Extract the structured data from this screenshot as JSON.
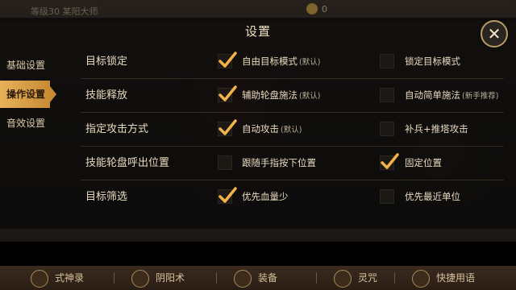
{
  "top": {
    "left_text": "等级30 某阳大师",
    "coins": "0"
  },
  "panel": {
    "title": "设置"
  },
  "sidebar": {
    "items": [
      {
        "label": "基础设置"
      },
      {
        "label": "操作设置"
      },
      {
        "label": "音效设置"
      }
    ]
  },
  "rows": [
    {
      "label": "目标锁定",
      "opt1": "自由目标模式",
      "opt1_tag": "(默认)",
      "opt1_checked": true,
      "opt2": "锁定目标模式",
      "opt2_tag": "",
      "opt2_checked": false
    },
    {
      "label": "技能释放",
      "opt1": "辅助轮盘施法",
      "opt1_tag": "(默认)",
      "opt1_checked": true,
      "opt2": "自动简单施法",
      "opt2_tag": "(新手推荐)",
      "opt2_checked": false
    },
    {
      "label": "指定攻击方式",
      "opt1": "自动攻击",
      "opt1_tag": "(默认)",
      "opt1_checked": true,
      "opt2": "补兵+推塔攻击",
      "opt2_tag": "",
      "opt2_checked": false
    },
    {
      "label": "技能轮盘呼出位置",
      "opt1": "跟随手指按下位置",
      "opt1_tag": "",
      "opt1_checked": false,
      "opt2": "固定位置",
      "opt2_tag": "",
      "opt2_checked": true
    },
    {
      "label": "目标筛选",
      "opt1": "优先血量少",
      "opt1_tag": "",
      "opt1_checked": true,
      "opt2": "优先最近单位",
      "opt2_tag": "",
      "opt2_checked": false
    }
  ],
  "bottom": {
    "items": [
      {
        "label": "式神录"
      },
      {
        "label": "阴阳术"
      },
      {
        "label": "装备"
      },
      {
        "label": "灵咒"
      },
      {
        "label": "快捷用语"
      }
    ]
  }
}
